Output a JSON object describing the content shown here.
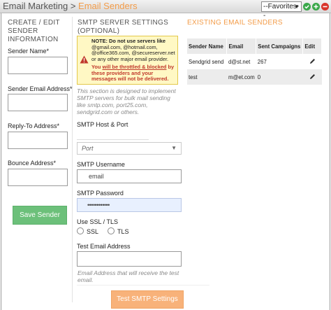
{
  "header": {
    "section": "Email Marketing",
    "separator": ">",
    "page": "Email Senders",
    "favorites_label": "--Favorites--",
    "accent_color": "#f39c49"
  },
  "left": {
    "title_lines": [
      "CREATE / EDIT",
      "SENDER",
      "INFORMATION"
    ],
    "fields": {
      "sender_name": "Sender Name*",
      "sender_email": "Sender Email Address*",
      "reply_to": "Reply-To Address*",
      "bounce": "Bounce Address*"
    },
    "save_button": "Save Sender",
    "button_color": "#6cc07a"
  },
  "smtp": {
    "title_lines": [
      "SMTP SERVER SETTINGS",
      "(OPTIONAL)"
    ],
    "note_line1": "NOTE: Do not use servers like",
    "note_line2": "@gmail.com, @hotmail.com,",
    "note_line3": "@office365.com, @secureserver.net",
    "note_line4": "or any other major email provider.",
    "note_w1": "You ",
    "note_w2": "will be throttled & blocked",
    "note_w3": " by",
    "note_w4": "these providers and your",
    "note_w5": "messages will not be delivered.",
    "help_line1": "This section is designed to implement",
    "help_line2": "SMTP servers for bulk mail sending",
    "help_line3": "like smtp.com, port25.com,",
    "help_line4": "sendgrid.com or others.",
    "host_label": "SMTP Host & Port",
    "port_placeholder": "Port",
    "username_label": "SMTP Username",
    "username_value": "email",
    "password_label": "SMTP Password",
    "password_value": "••••••••••••",
    "ssl_label": "Use SSL / TLS",
    "ssl_option": "SSL",
    "tls_option": "TLS",
    "test_email_label": "Test Email Address",
    "test_help_line1": "Email Address that will receive the test",
    "test_help_line2": "email.",
    "test_button": "Test SMTP Settings",
    "button_color": "#f8b27a"
  },
  "existing": {
    "title": "EXISTING EMAIL SENDERS",
    "columns": [
      "Sender Name",
      "Email",
      "Sent Campaigns",
      "Edit"
    ],
    "rows": [
      {
        "name": "Sendgrid send",
        "email": "d@st.net",
        "sent": "267"
      },
      {
        "name": "test",
        "email": "m@et.com",
        "sent": "0"
      }
    ]
  },
  "icons": {
    "favorites_go": "check-circle-icon",
    "add": "plus-circle-icon",
    "remove": "remove-circle-icon",
    "warning": "warning-icon",
    "edit": "pencil-icon"
  }
}
